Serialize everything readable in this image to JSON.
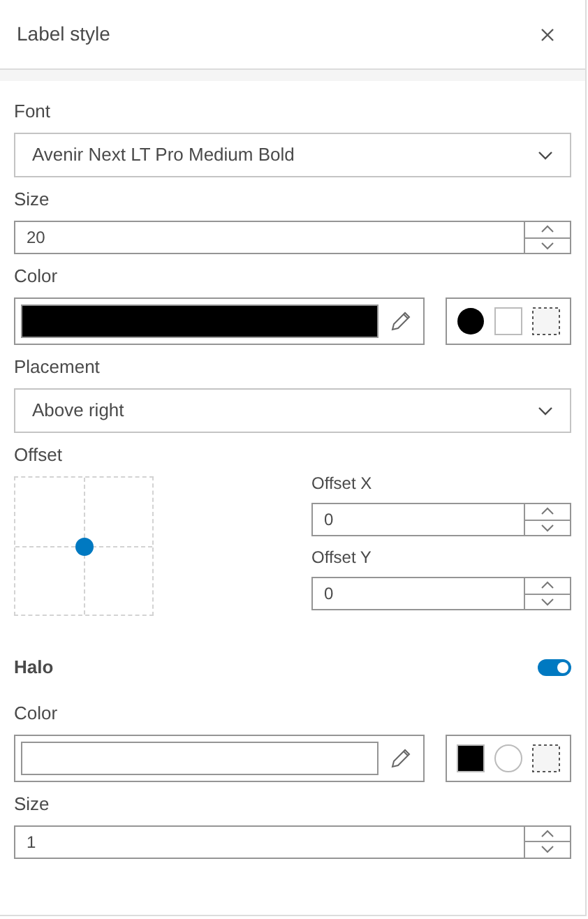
{
  "panel": {
    "title": "Label style"
  },
  "font": {
    "label": "Font",
    "value": "Avenir Next LT Pro Medium Bold"
  },
  "size": {
    "label": "Size",
    "value": "20"
  },
  "color": {
    "label": "Color",
    "swatch": {
      "color": "#000000"
    },
    "presets": [
      {
        "kind": "circle",
        "color": "#000000"
      },
      {
        "kind": "square",
        "color": "#ffffff"
      },
      {
        "kind": "transparent"
      }
    ]
  },
  "placement": {
    "label": "Placement",
    "value": "Above right"
  },
  "offset": {
    "label": "Offset",
    "x_label": "Offset X",
    "x_value": "0",
    "y_label": "Offset Y",
    "y_value": "0"
  },
  "halo": {
    "label": "Halo",
    "on": true,
    "color": {
      "label": "Color",
      "swatch": {
        "color": "#ffffff"
      },
      "presets": [
        {
          "kind": "square",
          "color": "#000000"
        },
        {
          "kind": "circle",
          "color": "#ffffff"
        },
        {
          "kind": "transparent"
        }
      ]
    },
    "size": {
      "label": "Size",
      "value": "1"
    }
  }
}
